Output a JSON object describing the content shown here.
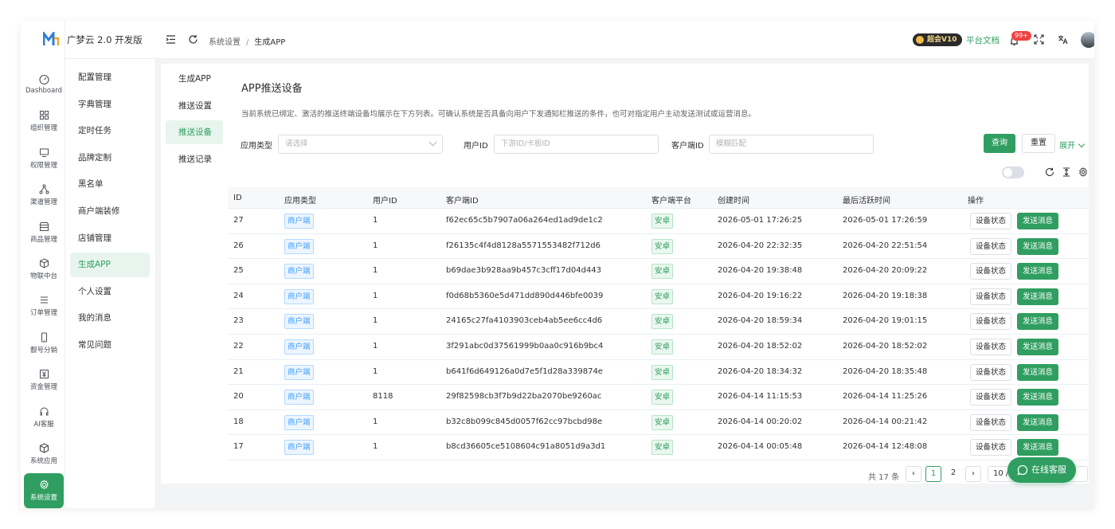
{
  "brand": {
    "name": "广梦云 2.0 开发版"
  },
  "rail": [
    {
      "label": "Dashboard",
      "icon": "dashboard-icon"
    },
    {
      "label": "组织管理",
      "icon": "grid-icon"
    },
    {
      "label": "权限管理",
      "icon": "monitor-icon"
    },
    {
      "label": "渠道管理",
      "icon": "share-icon"
    },
    {
      "label": "商品管理",
      "icon": "store-icon"
    },
    {
      "label": "物联中台",
      "icon": "box-icon"
    },
    {
      "label": "订单管理",
      "icon": "list-icon"
    },
    {
      "label": "靓号分销",
      "icon": "phone-icon"
    },
    {
      "label": "资金管理",
      "icon": "money-icon"
    },
    {
      "label": "AI客服",
      "icon": "headset-icon"
    },
    {
      "label": "系统应用",
      "icon": "cube-icon"
    },
    {
      "label": "系统设置",
      "icon": "settings-icon",
      "active": true
    }
  ],
  "submenu": [
    "配置管理",
    "字典管理",
    "定时任务",
    "品牌定制",
    "黑名单",
    "商户端装修",
    "店铺管理",
    "生成APP",
    "个人设置",
    "我的消息",
    "常见问题"
  ],
  "submenu_active": "生成APP",
  "breadcrumb": {
    "parent": "系统设置",
    "separator": "/",
    "current": "生成APP"
  },
  "header": {
    "vip": "超会V10",
    "docs": "平台文档",
    "notify_badge": "99+"
  },
  "tabs": [
    "生成APP",
    "推送设置",
    "推送设备",
    "推送记录"
  ],
  "tabs_active": "推送设备",
  "page": {
    "title": "APP推送设备",
    "description": "当前系统已绑定、激活的推送终端设备均展示在下方列表。可确认系统是否具备向用户下发通知栏推送的条件，也可对指定用户主动发送测试或运营消息。"
  },
  "filters": {
    "app_type_label": "应用类型",
    "app_type_placeholder": "请选择",
    "user_id_label": "用户ID",
    "user_id_placeholder": "下游ID/卡板ID",
    "client_id_label": "客户端ID",
    "client_id_placeholder": "模糊匹配",
    "query": "查询",
    "reset": "重置",
    "expand": "展开"
  },
  "table": {
    "headers": [
      "ID",
      "应用类型",
      "用户ID",
      "客户端ID",
      "客户端平台",
      "创建时间",
      "最后活跃时间",
      "操作"
    ],
    "status_btn": "设备状态",
    "send_btn": "发送消息",
    "rows": [
      {
        "id": "27",
        "type": "商户端",
        "uid": "1",
        "cid": "f62ec65c5b7907a06a264ed1ad9de1c2",
        "platform": "安卓",
        "created": "2026-05-01 17:26:25",
        "active": "2026-05-01 17:26:59"
      },
      {
        "id": "26",
        "type": "商户端",
        "uid": "1",
        "cid": "f26135c4f4d8128a5571553482f712d6",
        "platform": "安卓",
        "created": "2026-04-20 22:32:35",
        "active": "2026-04-20 22:51:54"
      },
      {
        "id": "25",
        "type": "商户端",
        "uid": "1",
        "cid": "b69dae3b928aa9b457c3cff17d04d443",
        "platform": "安卓",
        "created": "2026-04-20 19:38:48",
        "active": "2026-04-20 20:09:22"
      },
      {
        "id": "24",
        "type": "商户端",
        "uid": "1",
        "cid": "f0d68b5360e5d471dd890d446bfe0039",
        "platform": "安卓",
        "created": "2026-04-20 19:16:22",
        "active": "2026-04-20 19:18:38"
      },
      {
        "id": "23",
        "type": "商户端",
        "uid": "1",
        "cid": "24165c27fa4103903ceb4ab5ee6cc4d6",
        "platform": "安卓",
        "created": "2026-04-20 18:59:34",
        "active": "2026-04-20 19:01:15"
      },
      {
        "id": "22",
        "type": "商户端",
        "uid": "1",
        "cid": "3f291abc0d37561999b0aa0c916b9bc4",
        "platform": "安卓",
        "created": "2026-04-20 18:52:02",
        "active": "2026-04-20 18:52:02"
      },
      {
        "id": "21",
        "type": "商户端",
        "uid": "1",
        "cid": "b641f6d649126a0d7e5f1d28a339874e",
        "platform": "安卓",
        "created": "2026-04-20 18:34:32",
        "active": "2026-04-20 18:35:48"
      },
      {
        "id": "20",
        "type": "商户端",
        "uid": "8118",
        "cid": "29f82598cb3f7b9d22ba2070be9260ac",
        "platform": "安卓",
        "created": "2026-04-14 11:15:53",
        "active": "2026-04-14 11:25:26"
      },
      {
        "id": "18",
        "type": "商户端",
        "uid": "1",
        "cid": "b32c8b099c845d0057f62cc97bcbd98e",
        "platform": "安卓",
        "created": "2026-04-14 00:20:02",
        "active": "2026-04-14 00:21:42"
      },
      {
        "id": "17",
        "type": "商户端",
        "uid": "1",
        "cid": "b8cd36605ce5108604c91a8051d9a3d1",
        "platform": "安卓",
        "created": "2026-04-14 00:05:48",
        "active": "2026-04-14 12:48:08"
      }
    ]
  },
  "pagination": {
    "total": "共 17 条",
    "pages": [
      "1",
      "2"
    ],
    "current": "1",
    "page_size": "10 /"
  },
  "service": {
    "label": "在线客服"
  },
  "colors": {
    "primary": "#2f9e60",
    "tag_blue": "#409eff"
  }
}
